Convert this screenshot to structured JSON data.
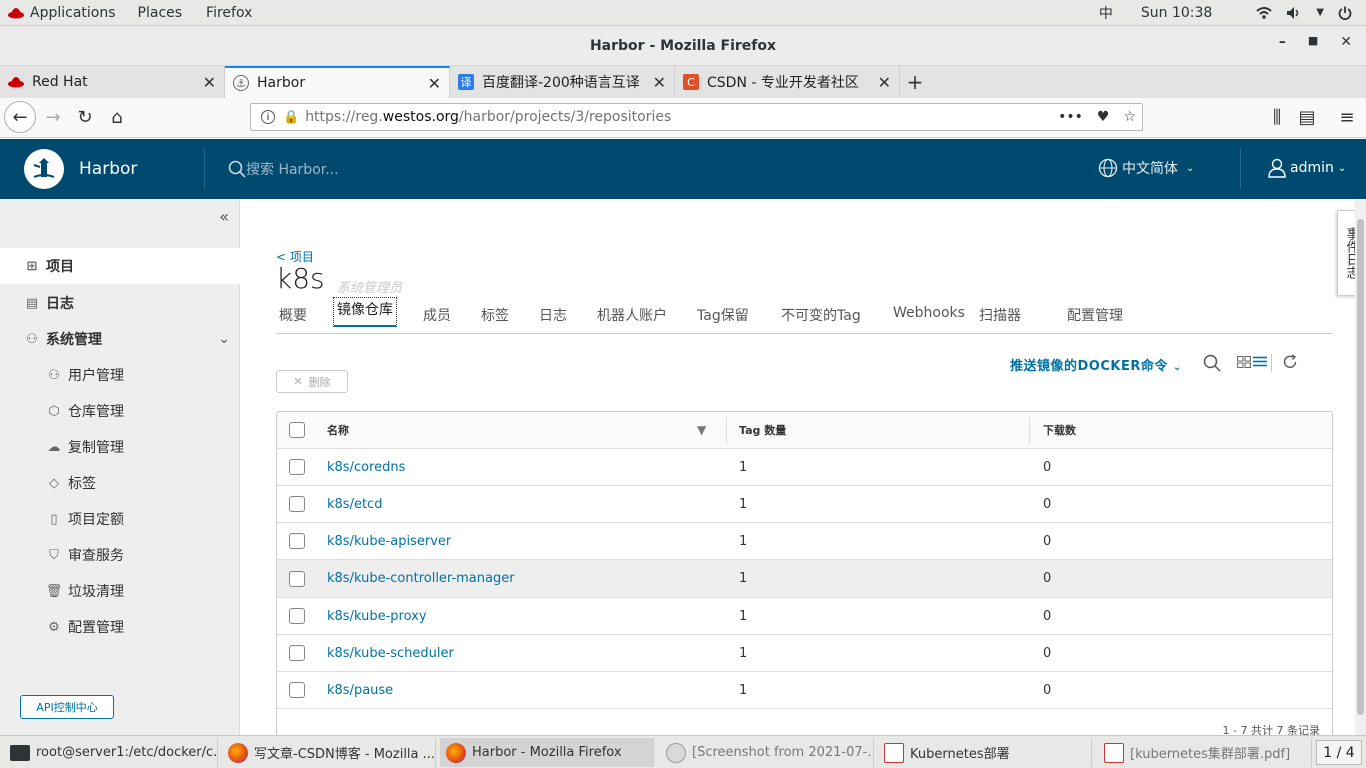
{
  "topbar": {
    "applications": "Applications",
    "places": "Places",
    "firefox": "Firefox",
    "ime": "中",
    "clock": "Sun 10:38"
  },
  "window": {
    "title": "Harbor - Mozilla Firefox"
  },
  "browser_tabs": [
    {
      "label": "Red Hat",
      "icon": "redhat-icon",
      "color": "#cc0000"
    },
    {
      "label": "Harbor",
      "icon": "harbor-icon",
      "color": "#666666"
    },
    {
      "label": "百度翻译-200种语言互译",
      "icon": "translate-icon",
      "color": "#2b7de9"
    },
    {
      "label": "CSDN - 专业开发者社区",
      "icon": "csdn-icon",
      "color": "#e0512a"
    }
  ],
  "url": {
    "pre": "https://reg.",
    "host": "westos.org",
    "path": "/harbor/projects/3/repositories"
  },
  "harbor": {
    "app_name": "Harbor",
    "search_placeholder": "搜索 Harbor...",
    "language": "中文简体",
    "user": "admin"
  },
  "sidebar": {
    "projects": "项目",
    "logs": "日志",
    "admin": "系统管理",
    "sub_items": [
      "用户管理",
      "仓库管理",
      "复制管理",
      "标签",
      "项目定额",
      "审查服务",
      "垃圾清理",
      "配置管理"
    ],
    "api_button": "API控制中心"
  },
  "project": {
    "breadcrumb": "< 项目",
    "name": "k8s",
    "role": "系统管理员",
    "tabs": [
      "概要",
      "镜像仓库",
      "成员",
      "标签",
      "日志",
      "机器人账户",
      "Tag保留",
      "不可变的Tag",
      "Webhooks",
      "扫描器",
      "配置管理"
    ],
    "push_command": "推送镜像的DOCKER命令",
    "delete_label": "删除"
  },
  "table": {
    "headers": {
      "name": "名称",
      "tags": "Tag 数量",
      "downloads": "下载数"
    },
    "rows": [
      {
        "name": "k8s/coredns",
        "tags": "1",
        "downloads": "0"
      },
      {
        "name": "k8s/etcd",
        "tags": "1",
        "downloads": "0"
      },
      {
        "name": "k8s/kube-apiserver",
        "tags": "1",
        "downloads": "0"
      },
      {
        "name": "k8s/kube-controller-manager",
        "tags": "1",
        "downloads": "0"
      },
      {
        "name": "k8s/kube-proxy",
        "tags": "1",
        "downloads": "0"
      },
      {
        "name": "k8s/kube-scheduler",
        "tags": "1",
        "downloads": "0"
      },
      {
        "name": "k8s/pause",
        "tags": "1",
        "downloads": "0"
      }
    ],
    "footer": "1 - 7 共计 7 条记录"
  },
  "event_log": "事件日志",
  "taskbar": {
    "items": [
      "root@server1:/etc/docker/c...",
      "写文章-CSDN博客 - Mozilla ...",
      "Harbor - Mozilla Firefox",
      "[Screenshot from 2021-07-...",
      "Kubernetes部署",
      "[kubernetes集群部署.pdf]"
    ],
    "workspace": "1 / 4"
  },
  "colors": {
    "harbor_header": "#004a70",
    "link": "#0072a3",
    "accent": "#0a84ff"
  }
}
